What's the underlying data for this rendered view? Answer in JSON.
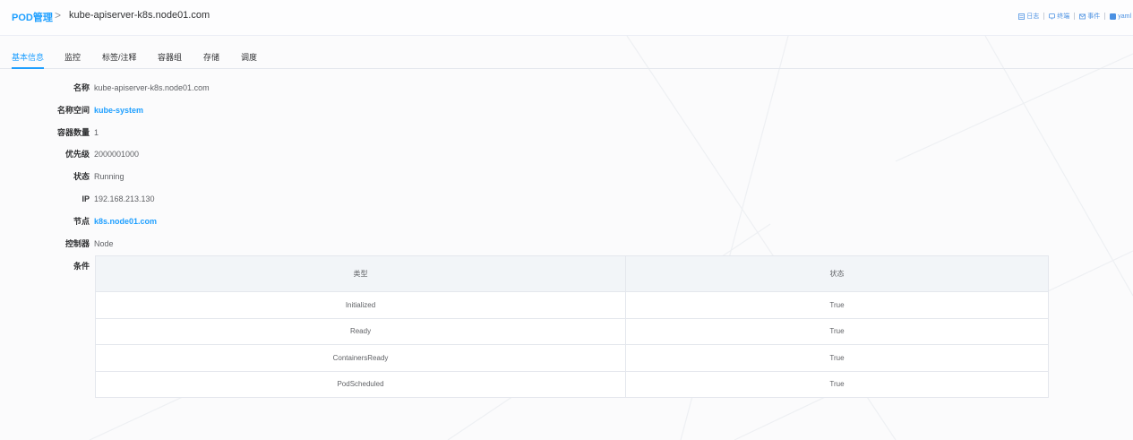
{
  "header": {
    "breadcrumb_root": "POD管理",
    "breadcrumb_separator": ">",
    "breadcrumb_current": "kube-apiserver-k8s.node01.com",
    "actions": [
      {
        "label": "日志",
        "icon": "log-icon"
      },
      {
        "label": "终端",
        "icon": "terminal-icon"
      },
      {
        "label": "事件",
        "icon": "event-icon"
      },
      {
        "label": "yaml",
        "icon": "yaml-icon"
      }
    ]
  },
  "tabs": [
    {
      "label": "基本信息",
      "active": true
    },
    {
      "label": "监控"
    },
    {
      "label": "标签/注释"
    },
    {
      "label": "容器组"
    },
    {
      "label": "存储"
    },
    {
      "label": "调度"
    }
  ],
  "info": {
    "name_label": "名称",
    "name_value": "kube-apiserver-k8s.node01.com",
    "namespace_label": "名称空间",
    "namespace_value": "kube-system",
    "container_count_label": "容器数量",
    "container_count_value": "1",
    "priority_label": "优先级",
    "priority_value": "2000001000",
    "status_label": "状态",
    "status_value": "Running",
    "ip_label": "IP",
    "ip_value": "192.168.213.130",
    "node_label": "节点",
    "node_value": "k8s.node01.com",
    "controller_label": "控制器",
    "controller_value": "Node",
    "conditions_label": "条件"
  },
  "conditions": {
    "headers": [
      "类型",
      "状态"
    ],
    "rows": [
      [
        "Initialized",
        "True"
      ],
      [
        "Ready",
        "True"
      ],
      [
        "ContainersReady",
        "True"
      ],
      [
        "PodScheduled",
        "True"
      ]
    ]
  },
  "colors": {
    "accent": "#1e9fff",
    "table_header_bg": "#f2f5f8",
    "border": "#e4e7ed"
  }
}
